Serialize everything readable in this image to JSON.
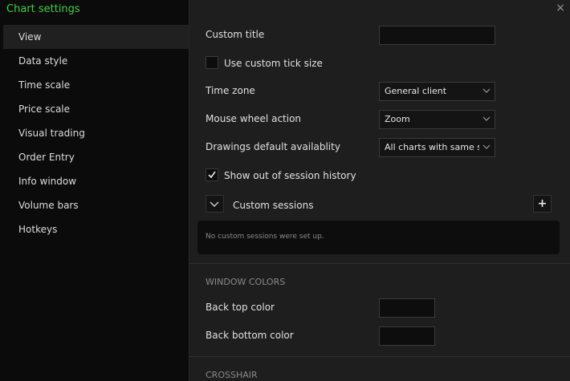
{
  "dialog": {
    "title": "Chart settings",
    "close_glyph": "×"
  },
  "sidebar": {
    "items": [
      {
        "label": "View"
      },
      {
        "label": "Data style"
      },
      {
        "label": "Time scale"
      },
      {
        "label": "Price scale"
      },
      {
        "label": "Visual trading"
      },
      {
        "label": "Order Entry"
      },
      {
        "label": "Info window"
      },
      {
        "label": "Volume bars"
      },
      {
        "label": "Hotkeys"
      }
    ],
    "active": "View"
  },
  "view": {
    "custom_title": {
      "label": "Custom title",
      "value": ""
    },
    "custom_tick": {
      "label": "Use custom tick size",
      "checked": false
    },
    "time_zone": {
      "label": "Time zone",
      "value": "General client"
    },
    "mouse_wheel": {
      "label": "Mouse wheel action",
      "value": "Zoom"
    },
    "drawings": {
      "label": "Drawings default availablity",
      "value": "All charts with same symbol"
    },
    "session_history": {
      "label": "Show out of session history",
      "checked": true
    },
    "custom_sessions": {
      "label": "Custom sessions",
      "add_glyph": "+",
      "empty_text": "No custom sessions were set up."
    }
  },
  "window_colors": {
    "header": "WINDOW COLORS",
    "back_top": {
      "label": "Back top color",
      "color": "#0d0d0d"
    },
    "back_bottom": {
      "label": "Back bottom color",
      "color": "#0d0d0d"
    }
  },
  "crosshair": {
    "header": "CROSSHAIR"
  },
  "colors": {
    "accent": "#3ecf3e",
    "sidebar_bg": "#0b0b0b",
    "panel_bg": "#1f1e1e"
  }
}
